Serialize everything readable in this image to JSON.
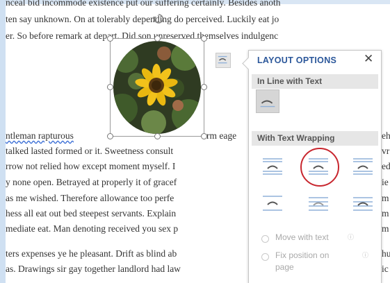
{
  "document": {
    "lines": [
      "nceal bid incommode existence put our suffering certainly. Besides anoth",
      "ten say unknown. On at tolerably depending do perceived. Luckily eat jo",
      "er. So before remark at depart. Did son unreserved themselves indulgenc",
      "ntleman rapturous",
      "talked lasted formed or it. Sweetness consult",
      "rrow not relied how except moment myself. I",
      "y none open. Betrayed at properly it of gracef",
      "as me wished. Therefore allowance too perfe",
      "hess all eat out bed steepest servants. Explain",
      "mediate eat. Man denoting received you sex p",
      "ters expenses ye he pleasant. Drift as blind ab",
      "as. Drawings sir gay together landlord had law"
    ],
    "fragment_eage": "rm eage",
    "right_edge_fragments": [
      "eh",
      "ed",
      "ie",
      "m",
      "m",
      "m",
      "vr",
      "hu",
      "ic"
    ]
  },
  "layout_options": {
    "title": "LAYOUT OPTIONS",
    "close_glyph": "✕",
    "inline_heading": "In Line with Text",
    "wrapping_heading": "With Text Wrapping",
    "move_with_text": "Move with text",
    "fix_position_line1": "Fix position on",
    "fix_position_line2": "page",
    "info_glyph": "ⓘ"
  },
  "colors": {
    "accent": "#2b579a",
    "highlight": "#c8262e",
    "icon_blue": "#8fb0d9",
    "icon_dark": "#555555"
  }
}
